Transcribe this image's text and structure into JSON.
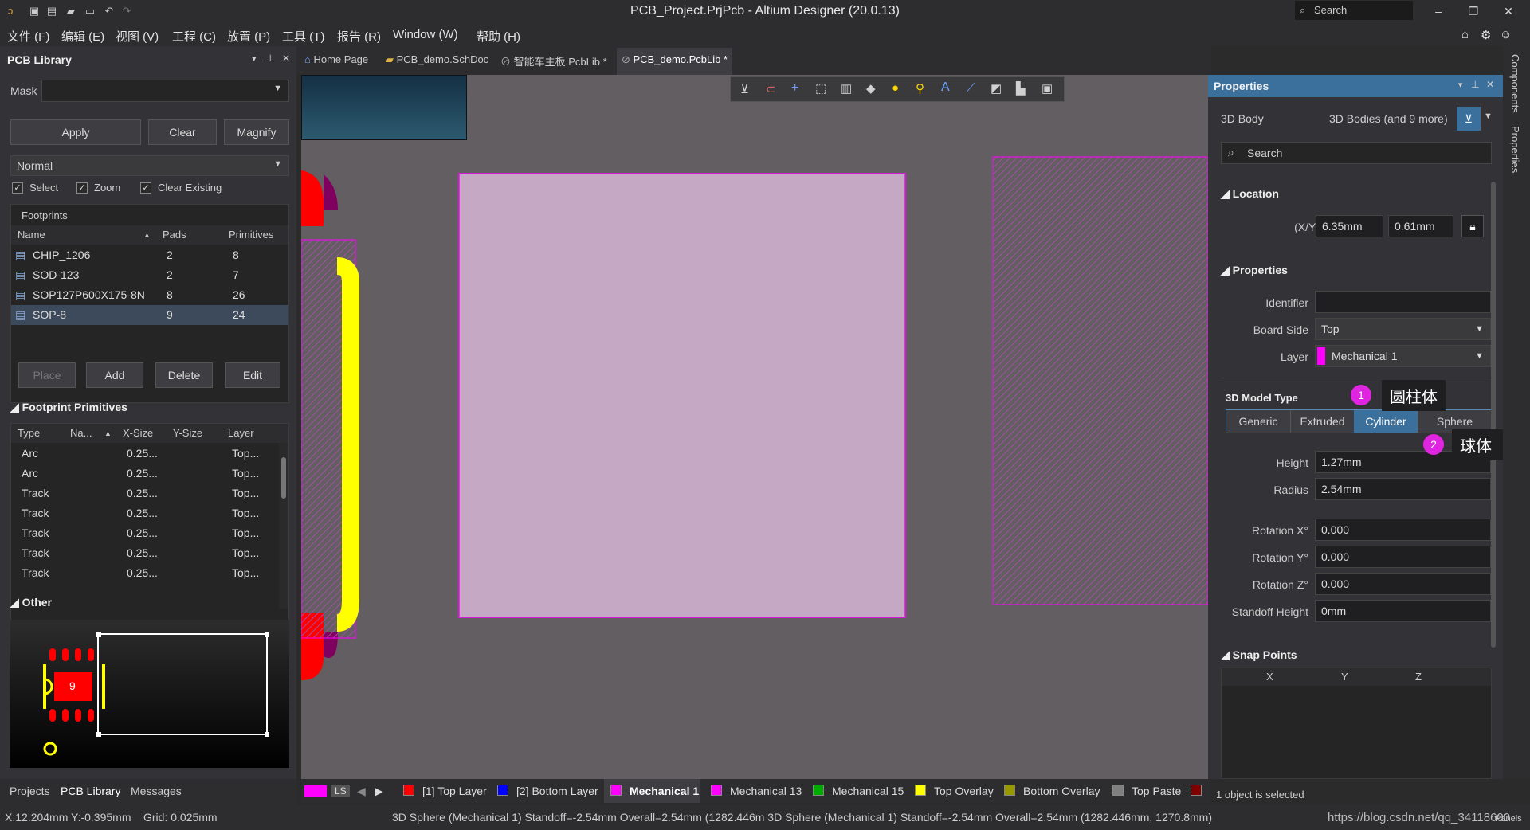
{
  "titlebar": {
    "title": "PCB_Project.PrjPcb - Altium Designer (20.0.13)",
    "search_placeholder": "Search"
  },
  "menu": [
    "文件 (F)",
    "编辑 (E)",
    "视图 (V)",
    "工程 (C)",
    "放置 (P)",
    "工具 (T)",
    "报告 (R)",
    "Window (W)",
    "帮助 (H)"
  ],
  "left_panel": {
    "title": "PCB Library",
    "mask_label": "Mask",
    "apply": "Apply",
    "clear": "Clear",
    "magnify": "Magnify",
    "mode": "Normal",
    "select": "Select",
    "zoom": "Zoom",
    "clear_existing": "Clear Existing",
    "footprints_label": "Footprints",
    "fp_headers": [
      "Name",
      "Pads",
      "Primitives"
    ],
    "footprints": [
      {
        "name": "CHIP_1206",
        "pads": "2",
        "prims": "8"
      },
      {
        "name": "SOD-123",
        "pads": "2",
        "prims": "7"
      },
      {
        "name": "SOP127P600X175-8N",
        "pads": "8",
        "prims": "26"
      },
      {
        "name": "SOP-8",
        "pads": "9",
        "prims": "24"
      }
    ],
    "place": "Place",
    "add": "Add",
    "delete": "Delete",
    "edit": "Edit",
    "primitives_label": "Footprint Primitives",
    "prim_headers": [
      "Type",
      "Na...",
      "X-Size",
      "Y-Size",
      "Layer"
    ],
    "primitives": [
      {
        "type": "Arc",
        "x": "0.25...",
        "layer": "Top..."
      },
      {
        "type": "Arc",
        "x": "0.25...",
        "layer": "Top..."
      },
      {
        "type": "Track",
        "x": "0.25...",
        "layer": "Top..."
      },
      {
        "type": "Track",
        "x": "0.25...",
        "layer": "Top..."
      },
      {
        "type": "Track",
        "x": "0.25...",
        "layer": "Top..."
      },
      {
        "type": "Track",
        "x": "0.25...",
        "layer": "Top..."
      },
      {
        "type": "Track",
        "x": "0.25...",
        "layer": "Top..."
      }
    ],
    "other_label": "Other",
    "preview_pad": "9",
    "bottom_tabs": [
      "Projects",
      "PCB Library",
      "Messages"
    ]
  },
  "tabs": [
    "Home Page",
    "PCB_demo.SchDoc",
    "智能车主板.PcbLib *",
    "PCB_demo.PcbLib *"
  ],
  "properties": {
    "title": "Properties",
    "kind": "3D Body",
    "filter": "3D Bodies (and 9 more)",
    "search": "Search",
    "location_label": "Location",
    "xy_label": "(X/Y)",
    "x": "6.35mm",
    "y": "0.61mm",
    "props_label": "Properties",
    "identifier_label": "Identifier",
    "identifier": "",
    "board_side_label": "Board Side",
    "board_side": "Top",
    "layer_label": "Layer",
    "layer": "Mechanical 1",
    "model_type_label": "3D Model Type",
    "model_types": [
      "Generic",
      "Extruded",
      "Cylinder",
      "Sphere"
    ],
    "height_label": "Height",
    "height": "1.27mm",
    "radius_label": "Radius",
    "radius": "2.54mm",
    "rotx_label": "Rotation X°",
    "rotx": "0.000",
    "roty_label": "Rotation Y°",
    "roty": "0.000",
    "rotz_label": "Rotation Z°",
    "rotz": "0.000",
    "standoff_label": "Standoff Height",
    "standoff": "0mm",
    "snap_label": "Snap Points",
    "snap_headers": [
      "X",
      "Y",
      "Z"
    ],
    "selected": "1 object is selected"
  },
  "annotations": {
    "badge1": "1",
    "tip1": "圆柱体",
    "badge2": "2",
    "tip2": "球体"
  },
  "layers": [
    {
      "name": "LS",
      "color": "#ff00ff"
    },
    {
      "name": "[1] Top Layer",
      "color": "#ff0000"
    },
    {
      "name": "[2] Bottom Layer",
      "color": "#0000ff"
    },
    {
      "name": "Mechanical 1",
      "color": "#ff00ff"
    },
    {
      "name": "Mechanical 13",
      "color": "#ff00ff"
    },
    {
      "name": "Mechanical 15",
      "color": "#00aa00"
    },
    {
      "name": "Top Overlay",
      "color": "#ffff00"
    },
    {
      "name": "Bottom Overlay",
      "color": "#999900"
    },
    {
      "name": "Top Paste",
      "color": "#808080"
    }
  ],
  "right_tabs": [
    "Components",
    "Properties"
  ],
  "status": {
    "coords": "X:12.204mm Y:-0.395mm",
    "grid": "Grid: 0.025mm",
    "info": "3D Sphere  (Mechanical 1)  Standoff=-2.54mm  Overall=2.54mm  (1282.446m 3D Sphere  (Mechanical 1)  Standoff=-2.54mm  Overall=2.54mm  (1282.446mm, 1270.8mm)",
    "watermark": "https://blog.csdn.net/qq_34118600",
    "panels": "Panels"
  }
}
